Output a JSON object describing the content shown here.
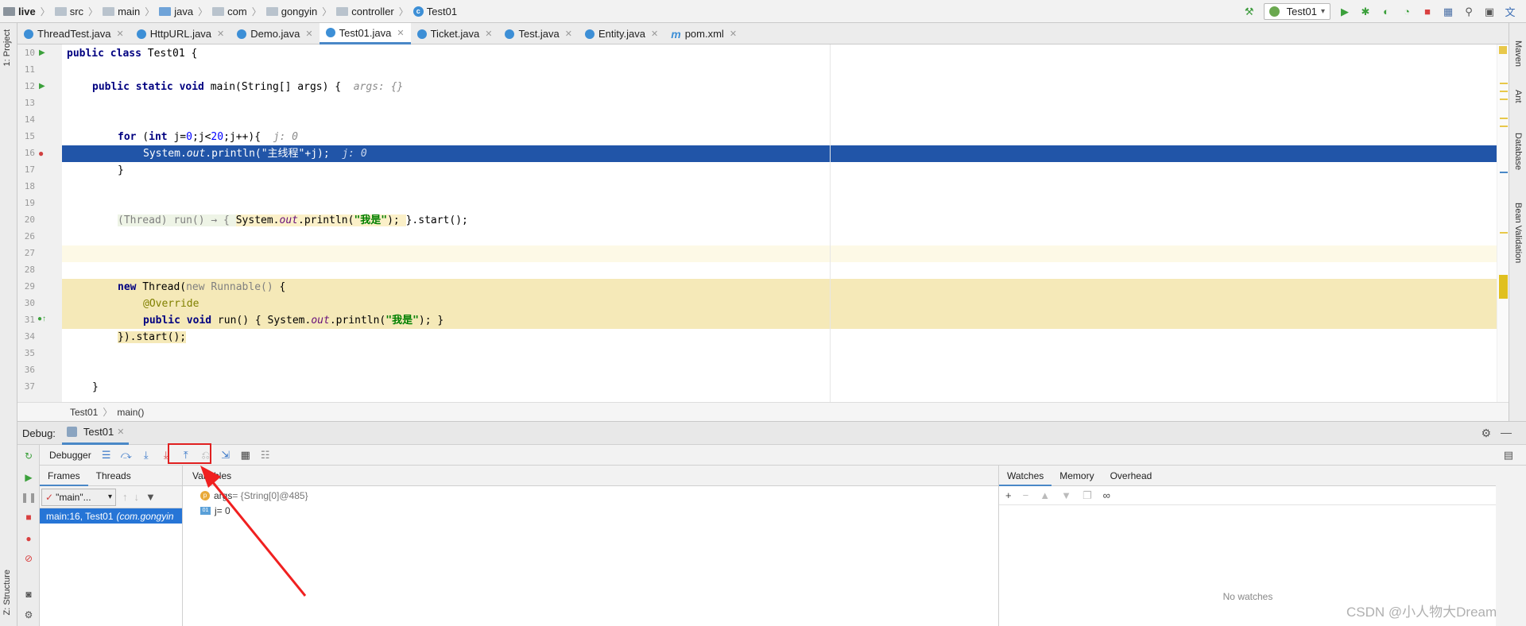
{
  "breadcrumb": [
    "live",
    "src",
    "main",
    "java",
    "com",
    "gongyin",
    "controller",
    "Test01"
  ],
  "run_config": "Test01",
  "tabs": [
    {
      "label": "ThreadTest.java",
      "icon": "class-icon",
      "active": false
    },
    {
      "label": "HttpURL.java",
      "icon": "class-icon",
      "active": false
    },
    {
      "label": "Demo.java",
      "icon": "class-icon",
      "active": false
    },
    {
      "label": "Test01.java",
      "icon": "class-icon",
      "active": true
    },
    {
      "label": "Ticket.java",
      "icon": "class-icon",
      "active": false
    },
    {
      "label": "Test.java",
      "icon": "class-icon",
      "active": false
    },
    {
      "label": "Entity.java",
      "icon": "class-icon",
      "active": false
    },
    {
      "label": "pom.xml",
      "icon": "maven-icon",
      "active": false
    }
  ],
  "left_tool_windows": {
    "project": "1: Project",
    "structure": "Z: Structure"
  },
  "right_tool_windows": [
    "Maven",
    "Ant",
    "Database",
    "Bean Validation"
  ],
  "line_numbers": [
    "10",
    "11",
    "12",
    "13",
    "14",
    "15",
    "16",
    "17",
    "18",
    "19",
    "20",
    "26",
    "27",
    "28",
    "29",
    "30",
    "31",
    "34",
    "35",
    "36",
    "37"
  ],
  "code": {
    "l10": {
      "kw": "public class",
      "rest": " Test01 {"
    },
    "l12": {
      "kw": "public static void",
      "rest": " main(String[] args) {",
      "hint": "args: {}"
    },
    "l15": {
      "kw1": "for",
      "p1": " (",
      "kw2": "int",
      "p2": " j=",
      "n1": "0",
      "p3": ";j<",
      "n2": "20",
      "p4": ";j++){",
      "hint": "j: 0"
    },
    "l16": {
      "a": "System.",
      "b": "out",
      "c": ".println(\"主线程\"+j);",
      "hint": "j: 0"
    },
    "l17": "}",
    "l20": {
      "a": "(Thread) run() → { ",
      "b": "System.",
      "c": "out",
      "d": ".println(",
      "e": "\"我是\"",
      "f": "); ",
      "g": "}.start();"
    },
    "l29": {
      "kw": "new",
      "a": " Thread(",
      "b": "new Runnable()",
      "c": " {"
    },
    "l30": "@Override",
    "l31": {
      "kw": "public void",
      "a": " run() { System.",
      "b": "out",
      "c": ".println(",
      "d": "\"我是\"",
      "e": "); }"
    },
    "l34": "}).start();",
    "l37": "}"
  },
  "editor_breadcrumb": [
    "Test01",
    "main()"
  ],
  "debug": {
    "label": "Debug:",
    "session": "Test01",
    "debugger_tab": "Debugger",
    "frames_tab": "Frames",
    "threads_tab": "Threads",
    "variables_tab": "Variables",
    "thread_select": "\"main\"...",
    "frame": "main:16, Test01",
    "frame_pkg": "(com.gongyin",
    "variables": [
      {
        "icon": "p",
        "name": "args",
        "value": " = {String[0]@485}"
      },
      {
        "icon": "01",
        "name": "j",
        "value": " = 0"
      }
    ],
    "watches_tabs": [
      "Watches",
      "Memory",
      "Overhead"
    ],
    "no_watches": "No watches"
  },
  "watermark": "CSDN @小人物大Dream",
  "colors": {
    "accent": "#4a88c7",
    "exec_line": "#2155a8",
    "highlight": "#fbf0c8",
    "annotation_box": "#e02020"
  }
}
